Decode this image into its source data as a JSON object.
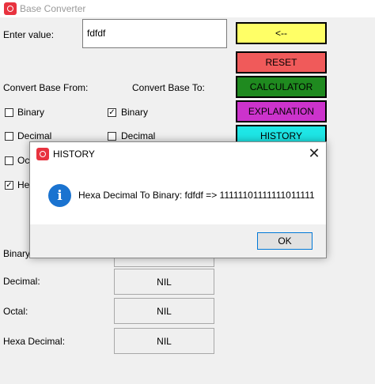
{
  "window": {
    "title": "Base Converter"
  },
  "input": {
    "label": "Enter value:",
    "value": "fdfdf"
  },
  "buttons": {
    "back": {
      "label": "<--",
      "color": "#ffff66"
    },
    "reset": {
      "label": "RESET",
      "color": "#f05a5a"
    },
    "calculator": {
      "label": "CALCULATOR",
      "color": "#1f8a1f"
    },
    "explanation": {
      "label": "EXPLANATION",
      "color": "#cc33cc"
    },
    "history": {
      "label": "HISTORY",
      "color": "#1ee6e6"
    }
  },
  "convert_from": {
    "label": "Convert Base From:",
    "options": [
      {
        "label": "Binary",
        "checked": false
      },
      {
        "label": "Decimal",
        "checked": false
      },
      {
        "label": "Oct",
        "checked": false
      },
      {
        "label": "He",
        "checked": true
      }
    ]
  },
  "convert_to": {
    "label": "Convert Base To:",
    "options": [
      {
        "label": "Binary",
        "checked": true
      },
      {
        "label": "Decimal",
        "checked": false
      }
    ]
  },
  "results": [
    {
      "label": "Binary:",
      "value": ""
    },
    {
      "label": "Decimal:",
      "value": "NIL"
    },
    {
      "label": "Octal:",
      "value": "NIL"
    },
    {
      "label": "Hexa Decimal:",
      "value": "NIL"
    }
  ],
  "dialog": {
    "title": "HISTORY",
    "message": "Hexa Decimal To Binary: fdfdf => 11111101111111011111",
    "ok_label": "OK",
    "close_glyph": "✕",
    "info_glyph": "i"
  }
}
